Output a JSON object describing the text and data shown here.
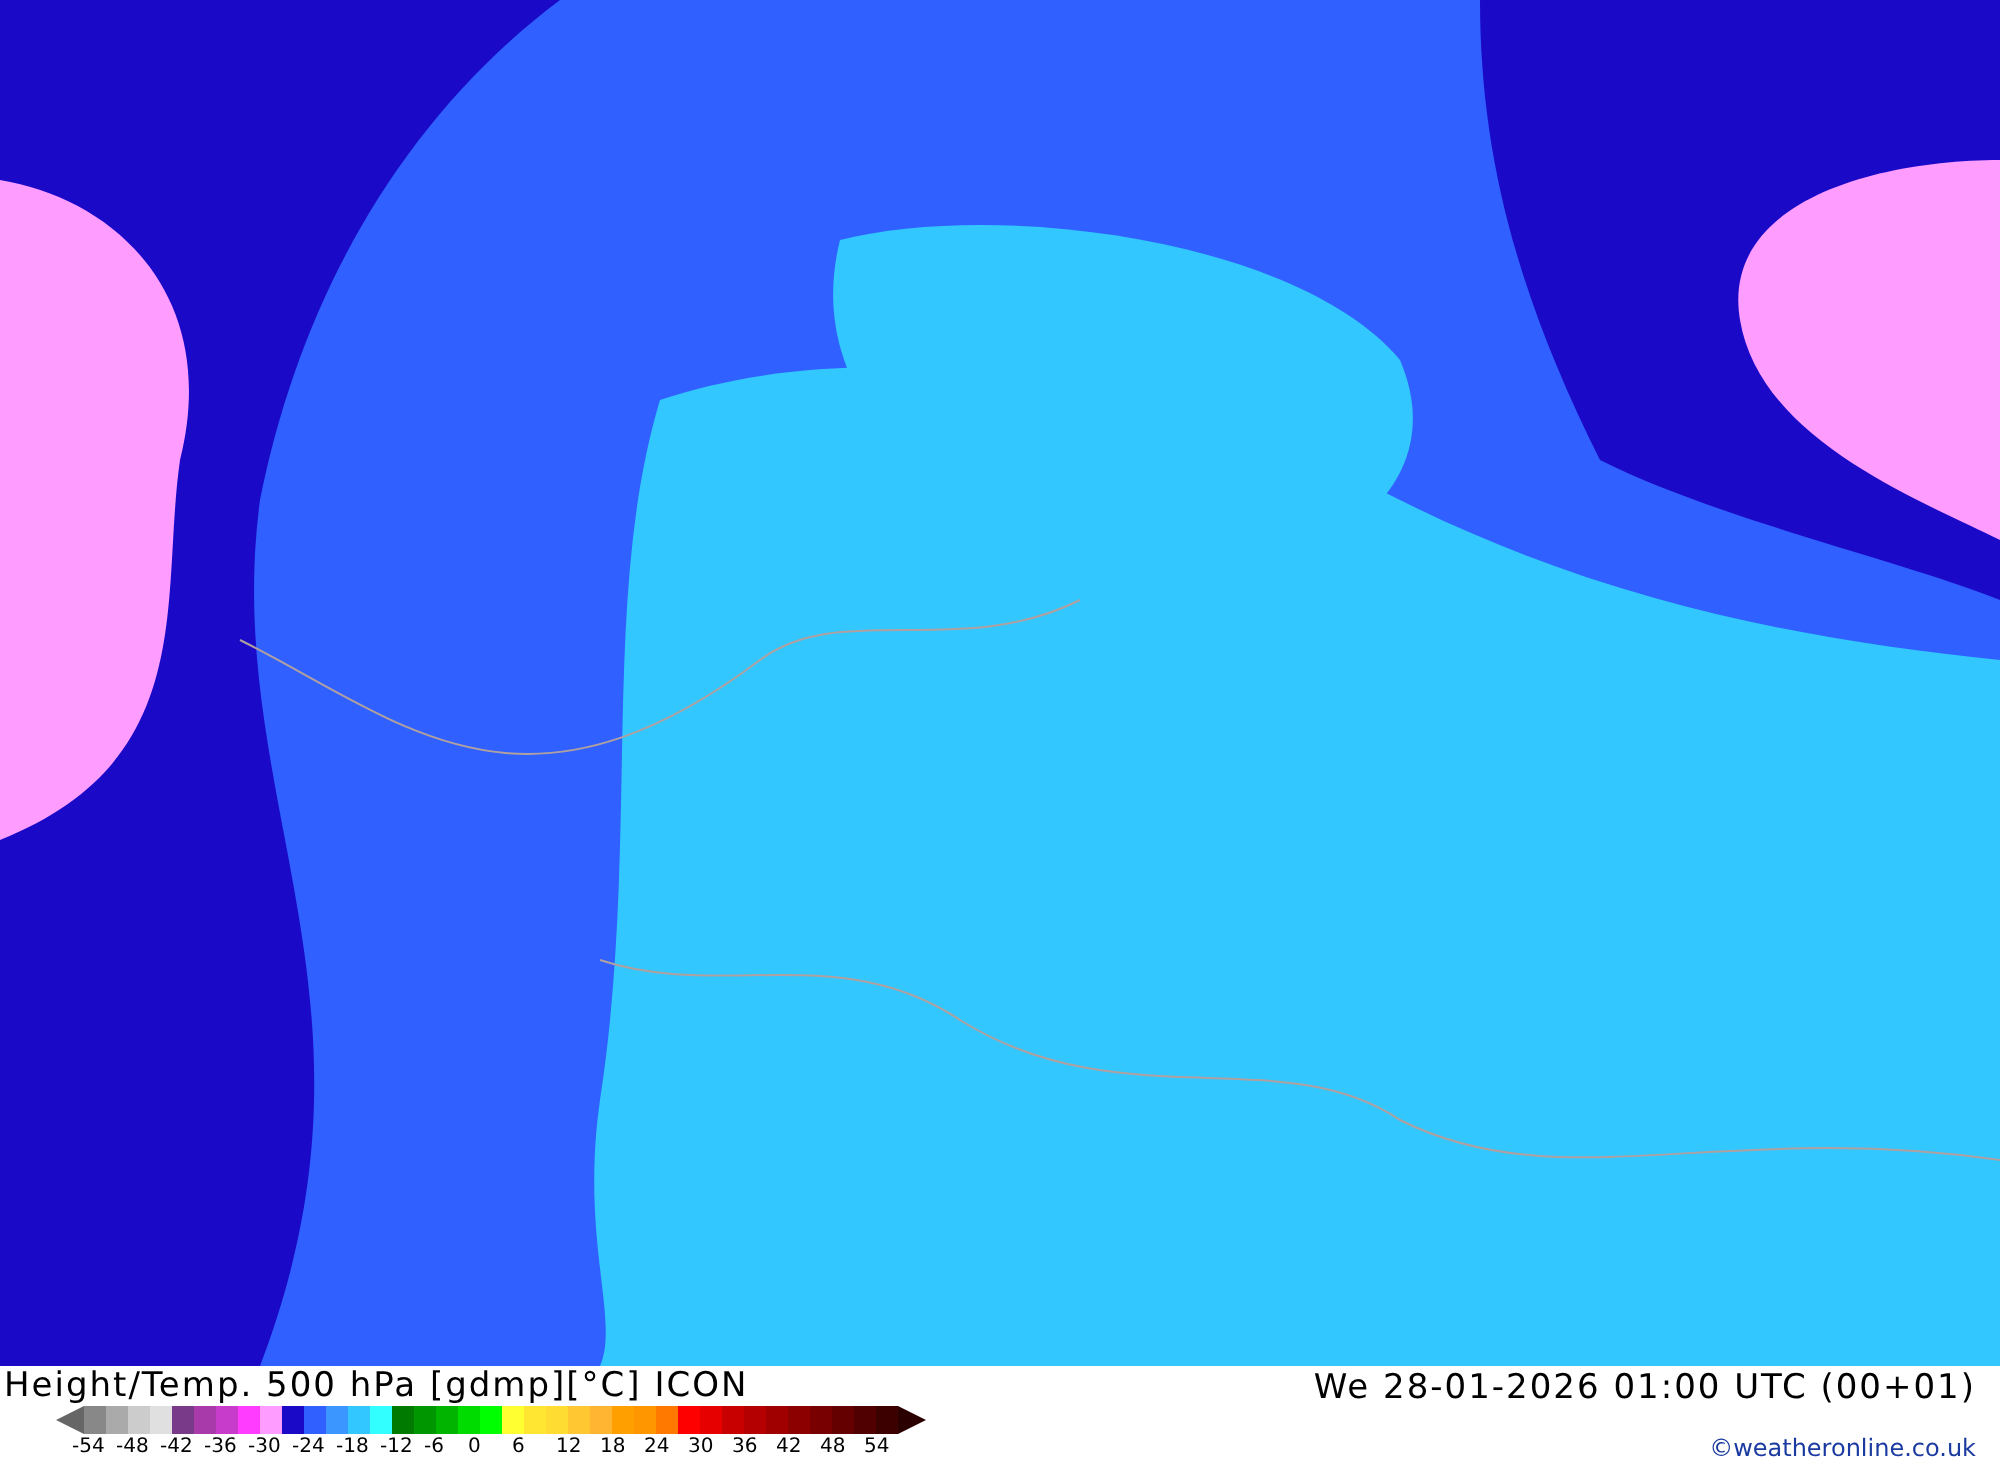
{
  "map": {
    "title": "Height/Temp. 500 hPa [gdmp][°C] ICON",
    "valid_time": "We 28-01-2026 01:00 UTC (00+01)",
    "credit": "©weatheronline.co.uk"
  },
  "legend": {
    "swatches": [
      {
        "color": "#888888"
      },
      {
        "color": "#aaaaaa"
      },
      {
        "color": "#cccccc"
      },
      {
        "color": "#e0e0e0"
      },
      {
        "color": "#7a3a8a"
      },
      {
        "color": "#a93aaa"
      },
      {
        "color": "#c83ccc"
      },
      {
        "color": "#ff3cff"
      },
      {
        "color": "#ff9cff"
      },
      {
        "color": "#1a0ac8"
      },
      {
        "color": "#3060ff"
      },
      {
        "color": "#3c96ff"
      },
      {
        "color": "#32c8ff"
      },
      {
        "color": "#32ffff"
      },
      {
        "color": "#007a00"
      },
      {
        "color": "#009600"
      },
      {
        "color": "#00b400"
      },
      {
        "color": "#00dc00"
      },
      {
        "color": "#00ff00"
      },
      {
        "color": "#ffff32"
      },
      {
        "color": "#ffe632"
      },
      {
        "color": "#ffdc32"
      },
      {
        "color": "#ffc832"
      },
      {
        "color": "#ffb432"
      },
      {
        "color": "#ffa000"
      },
      {
        "color": "#ff9600"
      },
      {
        "color": "#ff7800"
      },
      {
        "color": "#ff0000"
      },
      {
        "color": "#e60000"
      },
      {
        "color": "#c80000"
      },
      {
        "color": "#b40000"
      },
      {
        "color": "#a00000"
      },
      {
        "color": "#8c0000"
      },
      {
        "color": "#780000"
      },
      {
        "color": "#640000"
      },
      {
        "color": "#500000"
      },
      {
        "color": "#3c0000"
      }
    ],
    "ticks": [
      "-54",
      "-48",
      "-42",
      "-36",
      "-30",
      "-24",
      "-18",
      "-12",
      "-6",
      "0",
      "6",
      "12",
      "18",
      "24",
      "30",
      "36",
      "42",
      "48",
      "54"
    ]
  }
}
